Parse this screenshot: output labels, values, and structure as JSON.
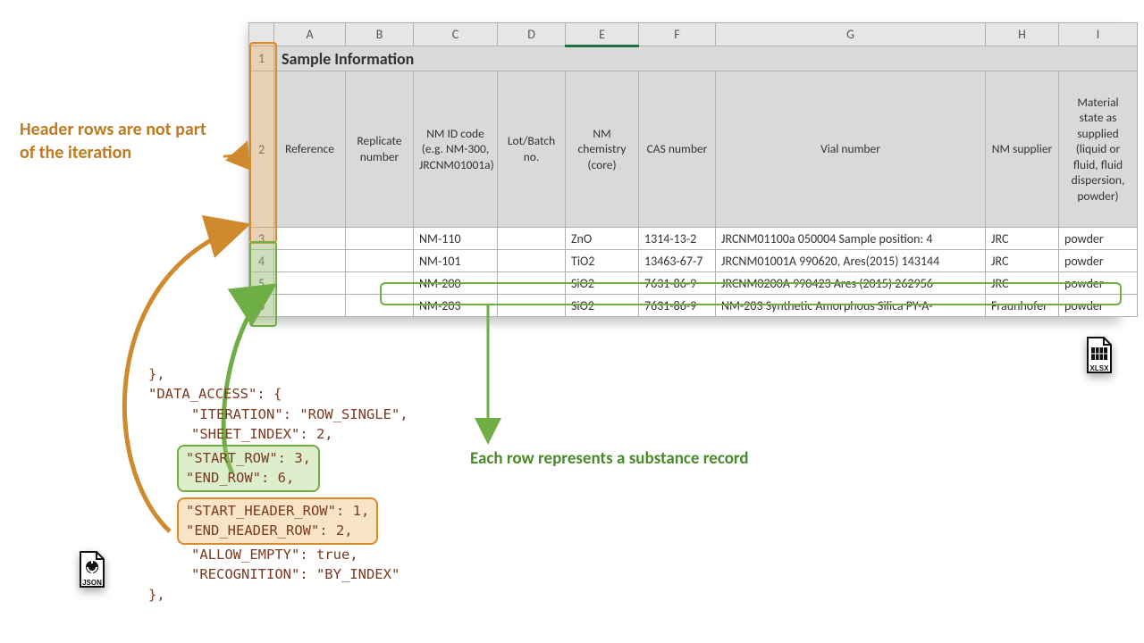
{
  "annotations": {
    "header_note": "Header rows are not part of the iteration",
    "row_note": "Each row represents a substance record"
  },
  "spreadsheet": {
    "columns": [
      "A",
      "B",
      "C",
      "D",
      "E",
      "F",
      "G",
      "H",
      "I"
    ],
    "title": "Sample Information",
    "headers": {
      "A": "Reference",
      "B": "Replicate number",
      "C": "NM ID code (e.g. NM-300, JRCNM01001a)",
      "D": "Lot/Batch no.",
      "E": "NM chemistry (core)",
      "F": "CAS number",
      "G": "Vial number",
      "H": "NM supplier",
      "I": "Material state as supplied (liquid or fluid, fluid dispersion, powder)"
    },
    "rows": [
      {
        "n": 3,
        "C": "NM-110",
        "E": "ZnO",
        "F": "1314-13-2",
        "G": "JRCNM01100a 050004 Sample position: 4",
        "H": "JRC",
        "I": "powder"
      },
      {
        "n": 4,
        "C": "NM-101",
        "E": "TiO2",
        "F": "13463-67-7",
        "G": "JRCNM01001A 990620, Ares(2015) 143144",
        "H": "JRC",
        "I": "powder"
      },
      {
        "n": 5,
        "C": "NM-200",
        "E": "SiO2",
        "F": "7631-86-9",
        "G": "JRCNM0200A 990423 Ares (2015) 262956",
        "H": "JRC",
        "I": "powder"
      },
      {
        "n": 6,
        "C": "NM-203",
        "E": "SiO2",
        "F": "7631-86-9",
        "G": "NM-203 Synthetic Amorphous Silica PY-A-",
        "H": "Fraunhofer",
        "I": "powder"
      }
    ]
  },
  "json_snippet": {
    "open": "},",
    "key": "\"DATA_ACCESS\": {",
    "lines": {
      "iteration": "\"ITERATION\": \"ROW_SINGLE\",",
      "sheet_index": "\"SHEET_INDEX\": 2,",
      "start_row": "\"START_ROW\": 3,",
      "end_row": "\"END_ROW\": 6,",
      "start_header": "\"START_HEADER_ROW\": 1,",
      "end_header": "\"END_HEADER_ROW\": 2,",
      "allow_empty": "\"ALLOW_EMPTY\": true,",
      "recognition": "\"RECOGNITION\": \"BY_INDEX\""
    },
    "close": "},"
  },
  "badges": {
    "json": "JSON",
    "xlsx": "XLSX"
  }
}
